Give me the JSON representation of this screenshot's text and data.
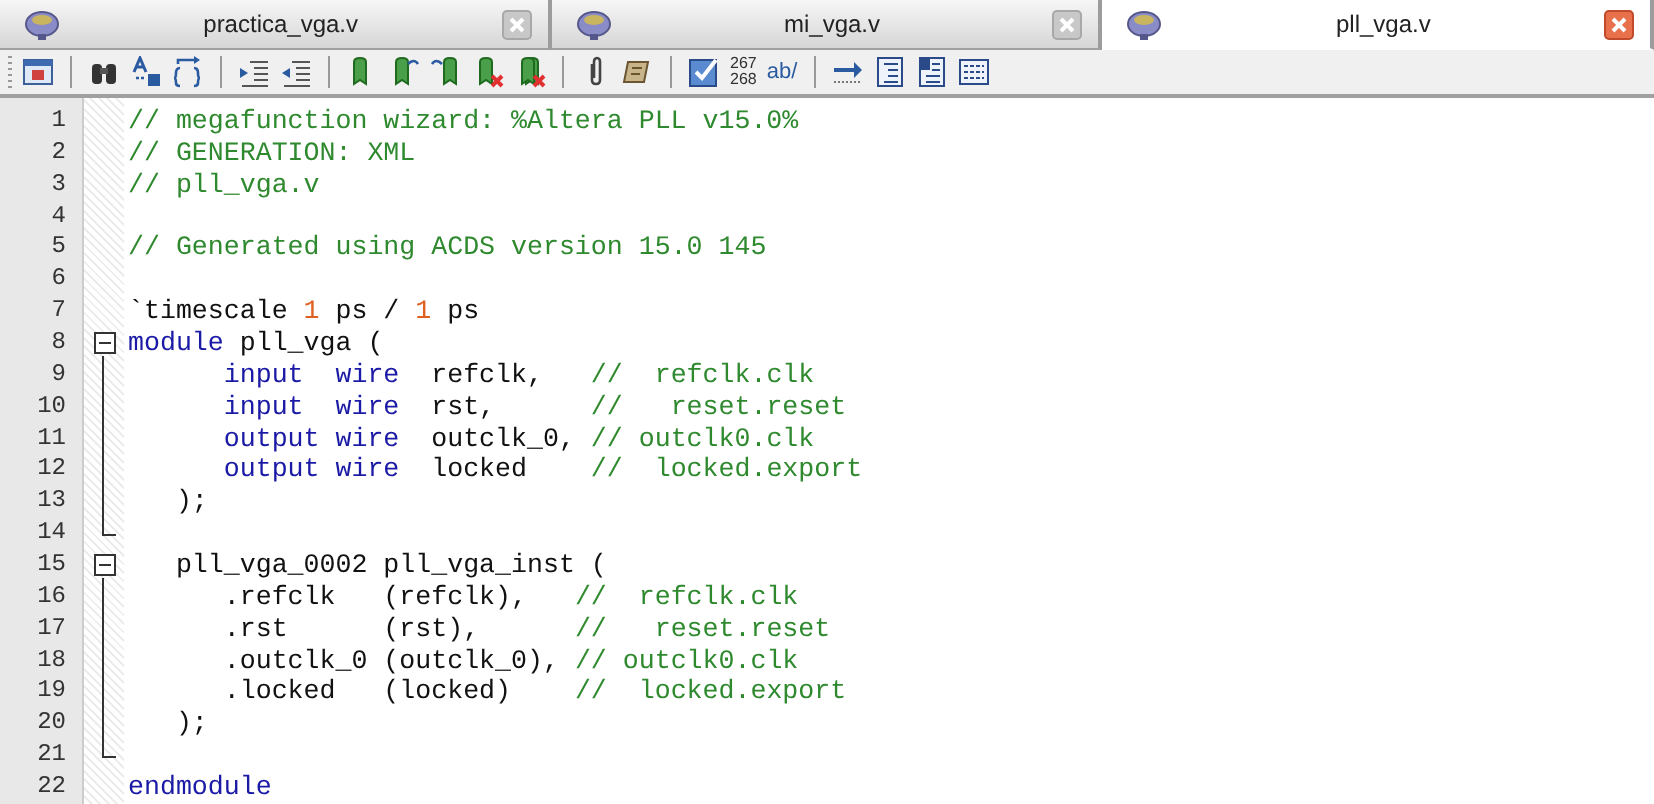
{
  "tabs": [
    {
      "label": "practica_vga.v",
      "selected": false
    },
    {
      "label": "mi_vga.v",
      "selected": false
    },
    {
      "label": "pll_vga.v",
      "selected": true
    }
  ],
  "toolbar": {
    "line_number_label": [
      "267",
      "268"
    ],
    "text_format_label": "ab/"
  },
  "editor": {
    "lines": [
      {
        "number": "1",
        "kind": "plain",
        "tokens": [
          {
            "kind": "comment",
            "text": "// megafunction wizard: %Altera PLL v15.0%"
          }
        ]
      },
      {
        "number": "2",
        "kind": "plain",
        "tokens": [
          {
            "kind": "comment",
            "text": "// GENERATION: XML"
          }
        ]
      },
      {
        "number": "3",
        "kind": "plain",
        "tokens": [
          {
            "kind": "comment",
            "text": "// pll_vga.v"
          }
        ]
      },
      {
        "number": "4",
        "kind": "plain"
      },
      {
        "number": "5",
        "kind": "plain",
        "tokens": [
          {
            "kind": "comment",
            "text": "// Generated using ACDS version 15.0 145"
          }
        ]
      },
      {
        "number": "6",
        "kind": "plain"
      },
      {
        "number": "7",
        "kind": "plain",
        "tokens": [
          {
            "kind": "plain",
            "text": "`timescale "
          },
          {
            "kind": "number",
            "text": "1"
          },
          {
            "kind": "plain",
            "text": " ps / "
          },
          {
            "kind": "number",
            "text": "1"
          },
          {
            "kind": "plain",
            "text": " ps"
          }
        ]
      },
      {
        "number": "8",
        "kind": "fold_start",
        "expanded": true,
        "tokens": [
          {
            "kind": "keyword",
            "text": "module"
          },
          {
            "kind": "plain",
            "text": " pll_vga ("
          }
        ]
      },
      {
        "number": "9",
        "kind": "fold_body",
        "tokens": [
          {
            "kind": "keyword",
            "text": "      input  wire"
          },
          {
            "kind": "plain",
            "text": "  refclk,   "
          },
          {
            "kind": "comment",
            "text": "//  refclk.clk"
          }
        ]
      },
      {
        "number": "10",
        "kind": "fold_body",
        "tokens": [
          {
            "kind": "keyword",
            "text": "      input  wire"
          },
          {
            "kind": "plain",
            "text": "  rst,      "
          },
          {
            "kind": "comment",
            "text": "//   reset.reset"
          }
        ]
      },
      {
        "number": "11",
        "kind": "fold_body",
        "tokens": [
          {
            "kind": "keyword",
            "text": "      output wire"
          },
          {
            "kind": "plain",
            "text": "  outclk_0, "
          },
          {
            "kind": "comment",
            "text": "// outclk0.clk"
          }
        ]
      },
      {
        "number": "12",
        "kind": "fold_body",
        "tokens": [
          {
            "kind": "keyword",
            "text": "      output wire"
          },
          {
            "kind": "plain",
            "text": "  locked    "
          },
          {
            "kind": "comment",
            "text": "//  locked.export"
          }
        ]
      },
      {
        "number": "13",
        "kind": "fold_body",
        "tokens": [
          {
            "kind": "plain",
            "text": "   );"
          }
        ]
      },
      {
        "number": "14",
        "kind": "fold_end"
      },
      {
        "number": "15",
        "kind": "fold_start",
        "expanded": true,
        "tokens": [
          {
            "kind": "plain",
            "text": "   pll_vga_0002 pll_vga_inst ("
          }
        ]
      },
      {
        "number": "16",
        "kind": "fold_body",
        "tokens": [
          {
            "kind": "plain",
            "text": "      .refclk   (refclk),   "
          },
          {
            "kind": "comment",
            "text": "//  refclk.clk"
          }
        ]
      },
      {
        "number": "17",
        "kind": "fold_body",
        "tokens": [
          {
            "kind": "plain",
            "text": "      .rst      (rst),      "
          },
          {
            "kind": "comment",
            "text": "//   reset.reset"
          }
        ]
      },
      {
        "number": "18",
        "kind": "fold_body",
        "tokens": [
          {
            "kind": "plain",
            "text": "      .outclk_0 (outclk_0), "
          },
          {
            "kind": "comment",
            "text": "// outclk0.clk"
          }
        ]
      },
      {
        "number": "19",
        "kind": "fold_body",
        "tokens": [
          {
            "kind": "plain",
            "text": "      .locked   (locked)    "
          },
          {
            "kind": "comment",
            "text": "//  locked.export"
          }
        ]
      },
      {
        "number": "20",
        "kind": "fold_body",
        "tokens": [
          {
            "kind": "plain",
            "text": "   );"
          }
        ]
      },
      {
        "number": "21",
        "kind": "fold_end"
      },
      {
        "number": "22",
        "kind": "plain",
        "tokens": [
          {
            "kind": "keyword",
            "text": "endmodule"
          }
        ]
      }
    ]
  }
}
